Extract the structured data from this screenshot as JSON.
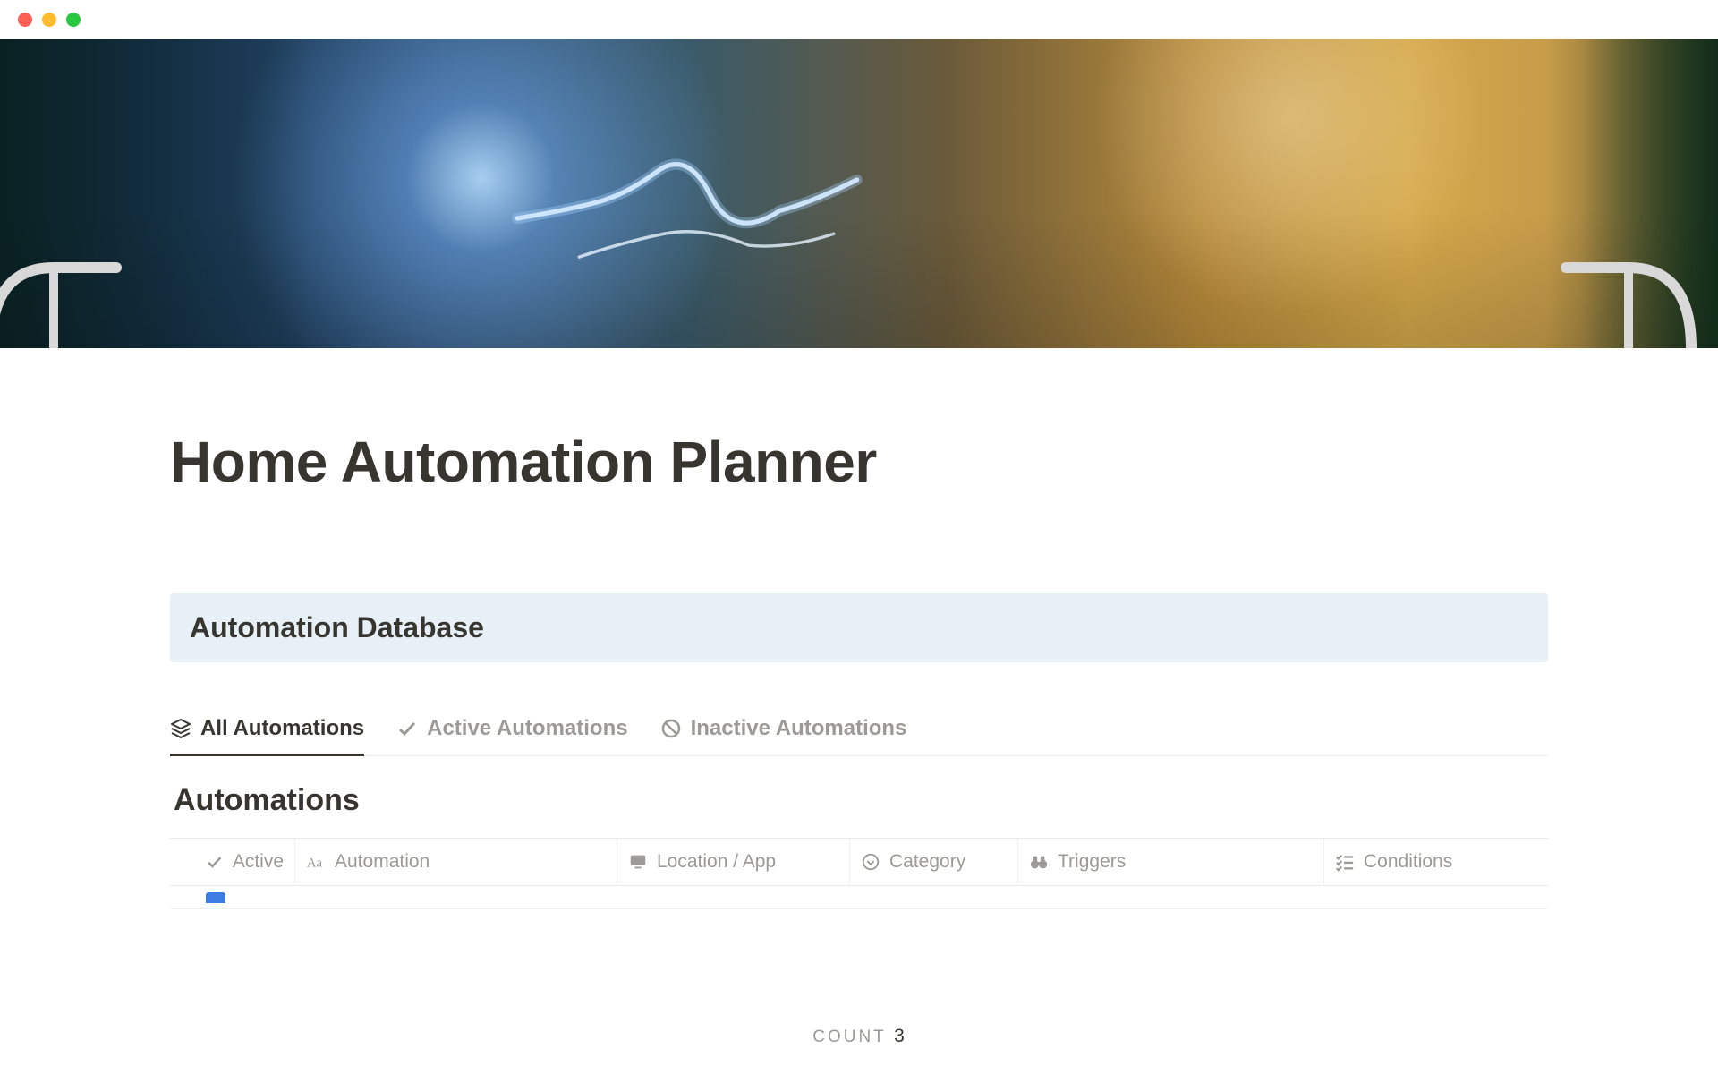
{
  "page": {
    "title": "Home Automation Planner"
  },
  "callout": {
    "title": "Automation Database"
  },
  "tabs": [
    {
      "label": "All Automations",
      "active": true,
      "icon": "stack"
    },
    {
      "label": "Active Automations",
      "active": false,
      "icon": "check"
    },
    {
      "label": "Inactive Automations",
      "active": false,
      "icon": "ban"
    }
  ],
  "database": {
    "title": "Automations",
    "columns": [
      {
        "label": "Active",
        "icon": "check"
      },
      {
        "label": "Automation",
        "icon": "title"
      },
      {
        "label": "Location / App",
        "icon": "monitor"
      },
      {
        "label": "Category",
        "icon": "select"
      },
      {
        "label": "Triggers",
        "icon": "binoculars"
      },
      {
        "label": "Conditions",
        "icon": "checklist"
      }
    ]
  },
  "footer": {
    "count_label": "COUNT",
    "count_value": "3"
  }
}
